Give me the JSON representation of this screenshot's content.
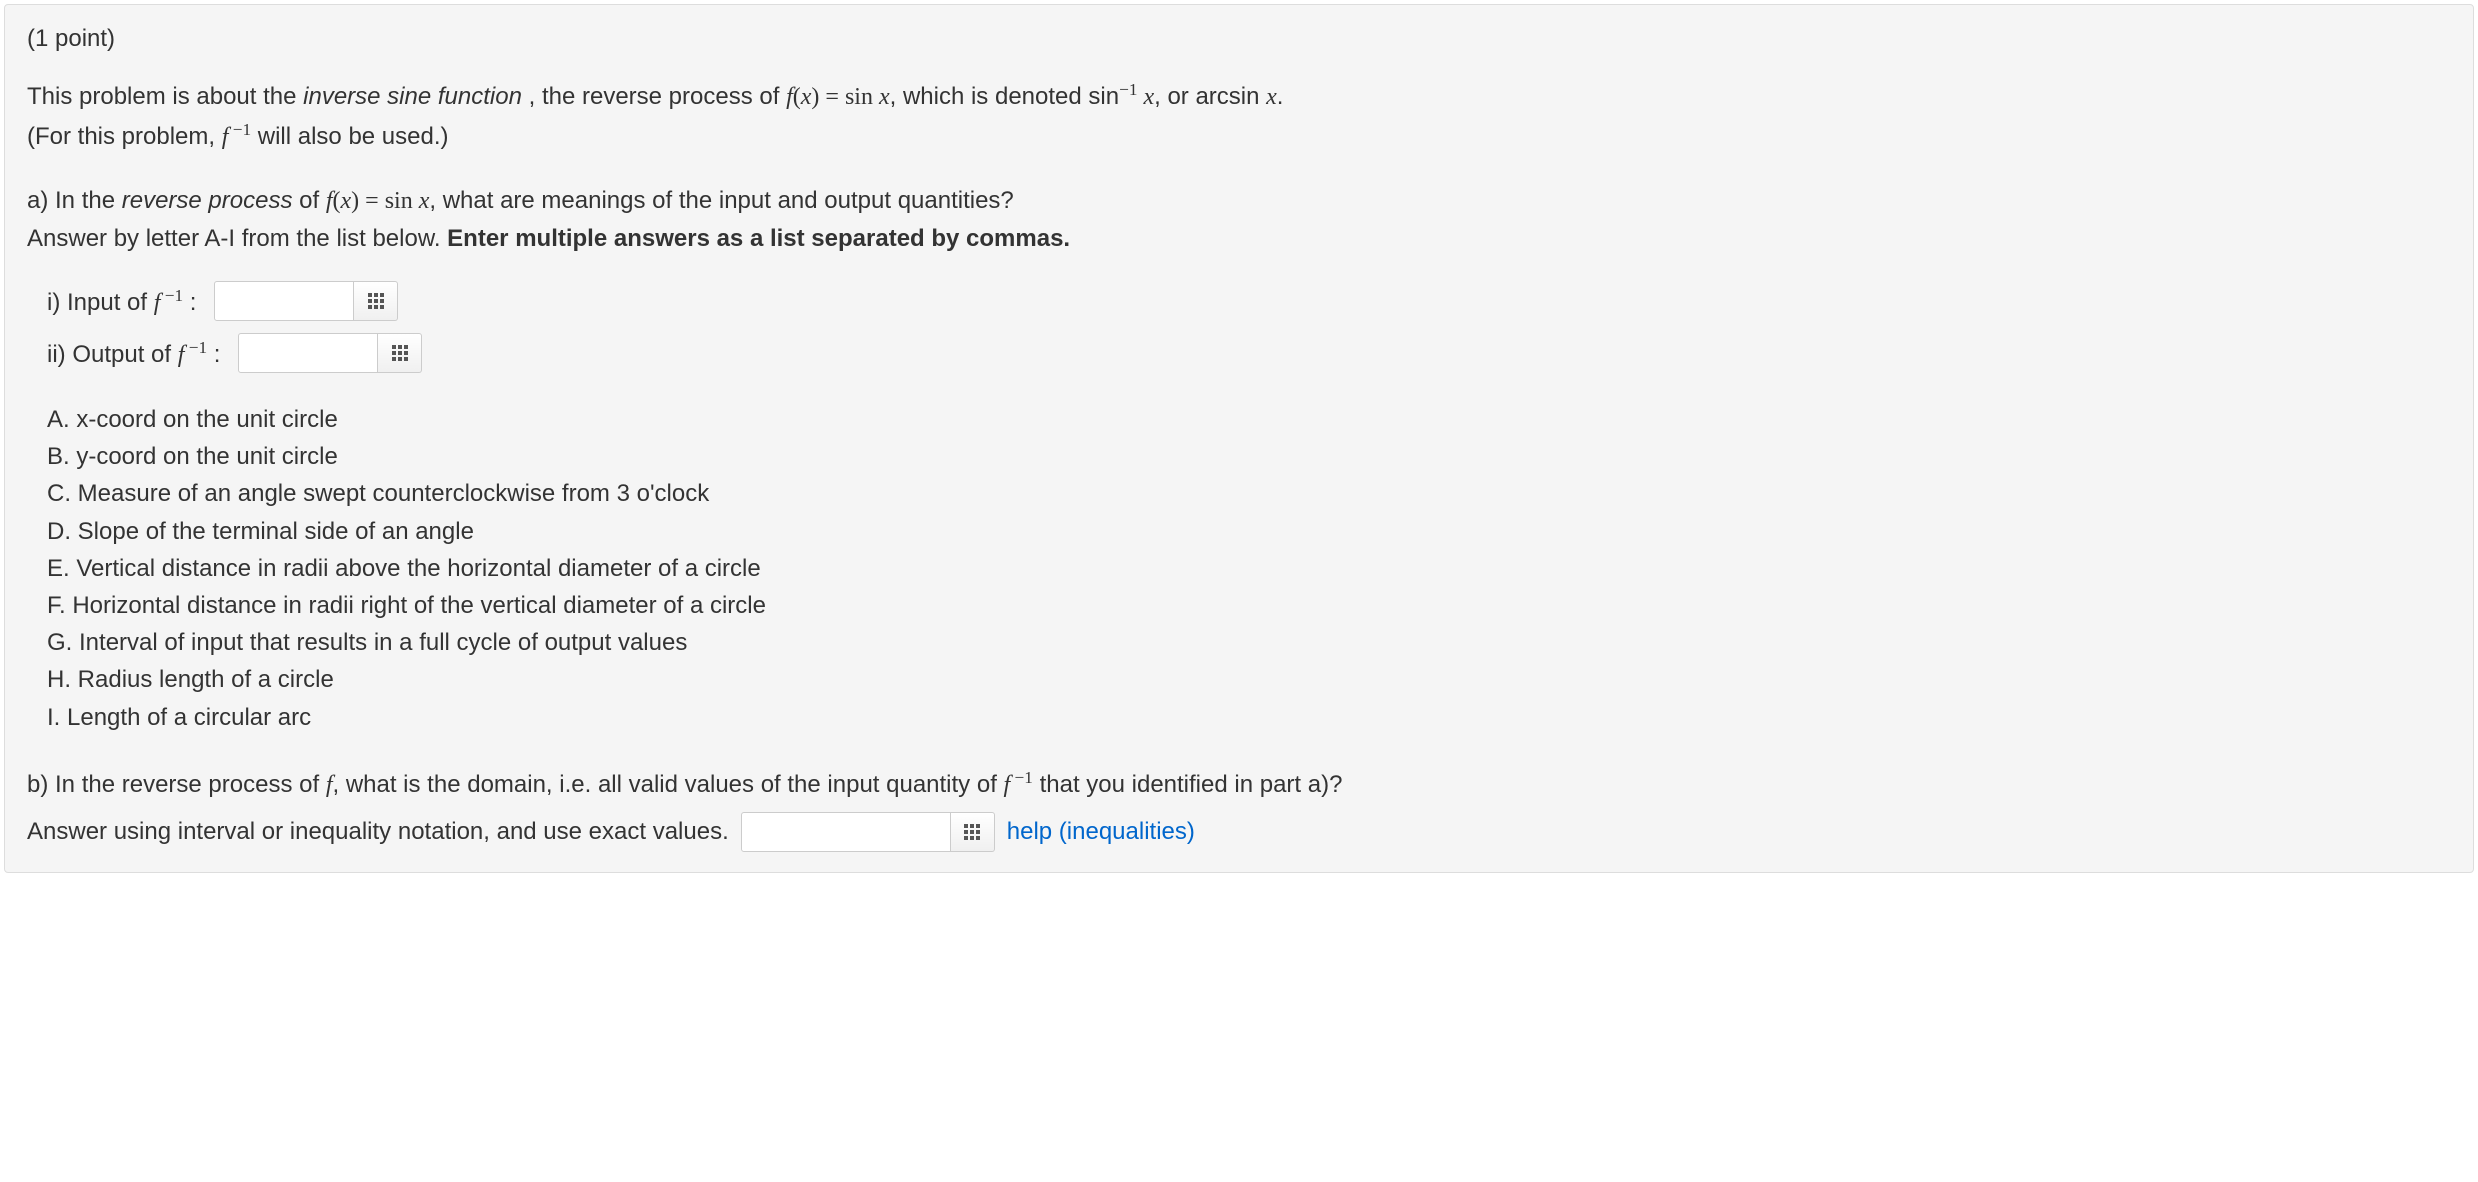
{
  "points": "(1 point)",
  "intro": {
    "p1_a": "This problem is about the ",
    "p1_italic": "inverse sine function",
    "p1_b": " , the reverse process of ",
    "p1_fx": "f",
    "p1_paren_open": "(",
    "p1_x": "x",
    "p1_paren_close": ")",
    "p1_eq": " = ",
    "p1_sin": "sin ",
    "p1_x2": "x",
    "p1_c": ", which is denoted sin",
    "p1_sup": "−1",
    "p1_x3": " x",
    "p1_d": ", or arcsin ",
    "p1_x4": "x",
    "p1_e": ".",
    "p2_a": "(For this problem, ",
    "p2_f": "f",
    "p2_sup": " −1",
    "p2_b": " will also be used.)"
  },
  "partA": {
    "line1_a": "a) In the ",
    "line1_italic": "reverse process",
    "line1_b": " of ",
    "line1_f": "f",
    "line1_paren_open": "(",
    "line1_x": "x",
    "line1_paren_close": ")",
    "line1_eq": " = ",
    "line1_sin": "sin ",
    "line1_x2": "x",
    "line1_c": ", what are meanings of the input and output quantities?",
    "line2_a": "Answer by letter A-I from the list below. ",
    "line2_bold": "Enter multiple answers as a list separated by commas.",
    "input_i_label_a": "i) Input of ",
    "input_i_f": "f",
    "input_i_sup": " −1",
    "input_i_colon": " :",
    "input_ii_label_a": "ii) Output of ",
    "input_ii_f": "f",
    "input_ii_sup": " −1",
    "input_ii_colon": " :"
  },
  "options": {
    "A": "A. x-coord on the unit circle",
    "B": "B. y-coord on the unit circle",
    "C": "C. Measure of an angle swept counterclockwise from 3 o'clock",
    "D": "D. Slope of the terminal side of an angle",
    "E": "E. Vertical distance in radii above the horizontal diameter of a circle",
    "F": "F. Horizontal distance in radii right of the vertical diameter of a circle",
    "G": "G. Interval of input that results in a full cycle of output values",
    "H": "H. Radius length of a circle",
    "I": "I. Length of a circular arc"
  },
  "partB": {
    "line1_a": "b) In the reverse process of ",
    "line1_f": "f",
    "line1_b": ", what is the domain, i.e. all valid values of the input quantity of ",
    "line1_f2": "f",
    "line1_sup": " −1",
    "line1_c": " that you identified in part a)?",
    "line2": "Answer using interval or inequality notation, and use exact values.",
    "help": "help (inequalities)"
  }
}
